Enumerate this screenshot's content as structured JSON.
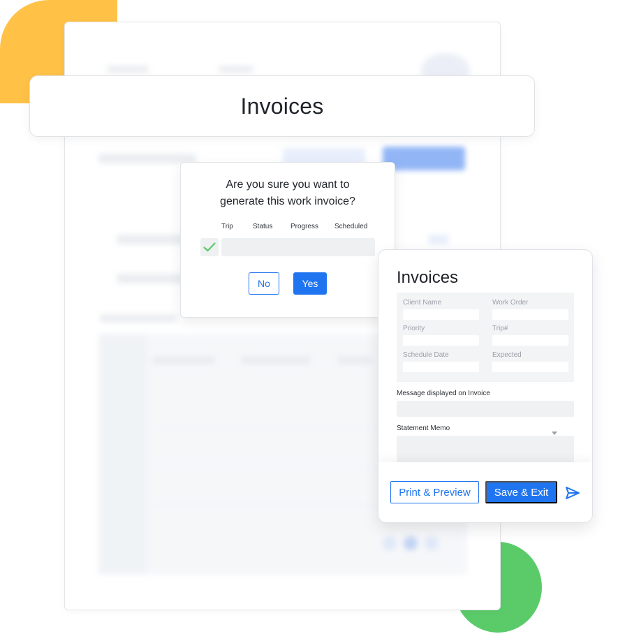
{
  "header": {
    "title": "Invoices"
  },
  "confirm_dialog": {
    "question_line1": "Are you sure you want to",
    "question_line2": "generate this work invoice?",
    "columns": [
      "Trip",
      "Status",
      "Progress",
      "Scheduled"
    ],
    "no_label": "No",
    "yes_label": "Yes"
  },
  "invoice_panel": {
    "title": "Invoices",
    "fields": {
      "client_name": "Client Name",
      "work_order": "Work Order",
      "priority": "Priority",
      "trip_number": "Trip#",
      "schedule_date": "Schedule Date",
      "expected": "Expected"
    },
    "message_label": "Message displayed on Invoice",
    "memo_label": "Statement Memo",
    "print_label": "Print & Preview",
    "save_label": "Save &  Exit"
  },
  "colors": {
    "accent": "#1F74F0",
    "yellow_blob": "#FFC247",
    "green_blob": "#5BCB6A",
    "check": "#5BCB6A"
  },
  "icons": [
    "check-icon",
    "send-icon",
    "caret-down-icon"
  ]
}
